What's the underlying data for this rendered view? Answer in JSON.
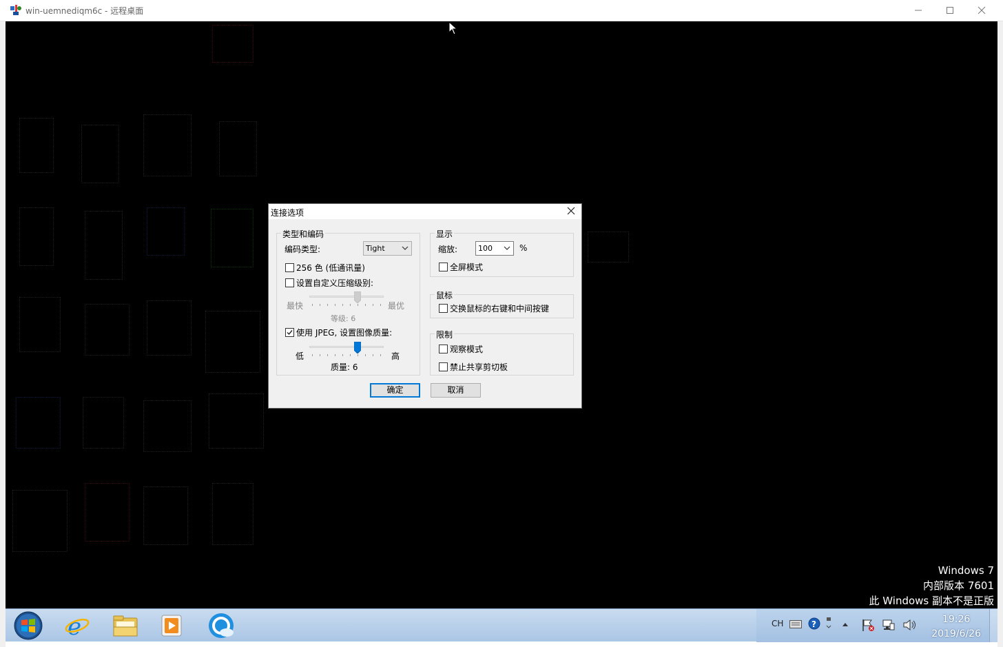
{
  "window": {
    "title": "win-uemnediqm6c - 远程桌面"
  },
  "watermark": {
    "line1": "Windows 7",
    "line2": "内部版本 7601",
    "line3": "此 Windows 副本不是正版"
  },
  "dialog": {
    "title": "连接选项",
    "encoding": {
      "group_label": "类型和编码",
      "type_label": "编码类型:",
      "type_value": "Tight",
      "color256_label": "256 色 (低通讯量)",
      "color256_checked": false,
      "custom_compress_label": "设置自定义压缩级别:",
      "custom_compress_checked": false,
      "compress_min_label": "最快",
      "compress_max_label": "最优",
      "compress_level_text": "等级: 6",
      "compress_level": 6,
      "compress_max": 9,
      "jpeg_label": "使用 JPEG, 设置图像质量:",
      "jpeg_checked": true,
      "quality_min_label": "低",
      "quality_max_label": "高",
      "quality_text": "质量: 6",
      "quality_level": 6,
      "quality_max": 9
    },
    "display": {
      "group_label": "显示",
      "zoom_label": "缩放:",
      "zoom_value": "100",
      "zoom_unit": "%",
      "fullscreen_label": "全屏模式",
      "fullscreen_checked": false
    },
    "mouse": {
      "group_label": "鼠标",
      "swap_label": "交换鼠标的右键和中间按键",
      "swap_checked": false
    },
    "restrict": {
      "group_label": "限制",
      "view_only_label": "观察模式",
      "view_only_checked": false,
      "no_clipboard_label": "禁止共享剪切板",
      "no_clipboard_checked": false
    },
    "ok_label": "确定",
    "cancel_label": "取消"
  },
  "taskbar": {
    "tray_lang": "CH",
    "clock_time": "19:26",
    "clock_date": "2019/6/26"
  },
  "colors": {
    "accent": "#0078d7",
    "remote_bg": "#000000",
    "dialog_bg": "#f0f0f0"
  }
}
